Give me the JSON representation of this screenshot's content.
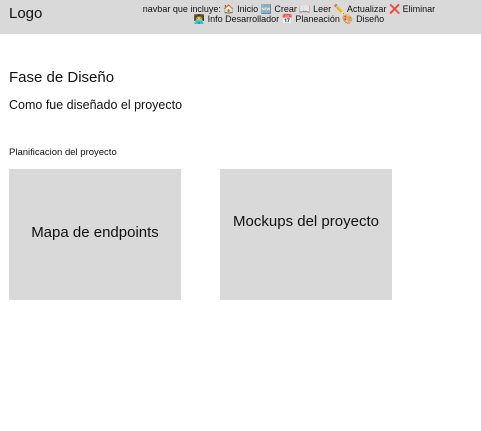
{
  "header": {
    "logo": "Logo",
    "navbar_description": "navbar que incluye:",
    "nav_items": [
      {
        "icon": "🏠",
        "label": "Inicio"
      },
      {
        "icon": "🆕",
        "label": "Crear"
      },
      {
        "icon": "📖",
        "label": "Leer"
      },
      {
        "icon": "✏️",
        "label": "Actualizar"
      },
      {
        "icon": "❌",
        "label": "Eliminar"
      },
      {
        "icon": "👨‍💻",
        "label": "Info Desarrollador"
      },
      {
        "icon": "📅",
        "label": "Planeación"
      },
      {
        "icon": "🎨",
        "label": "Diseño"
      }
    ]
  },
  "main": {
    "title": "Fase de Diseño",
    "subtitle": "Como fue diseñado el proyecto",
    "section_label": "Planificacion del proyecto",
    "cards": [
      {
        "label": "Mapa de endpoints"
      },
      {
        "label": "Mockups del proyecto"
      }
    ]
  }
}
